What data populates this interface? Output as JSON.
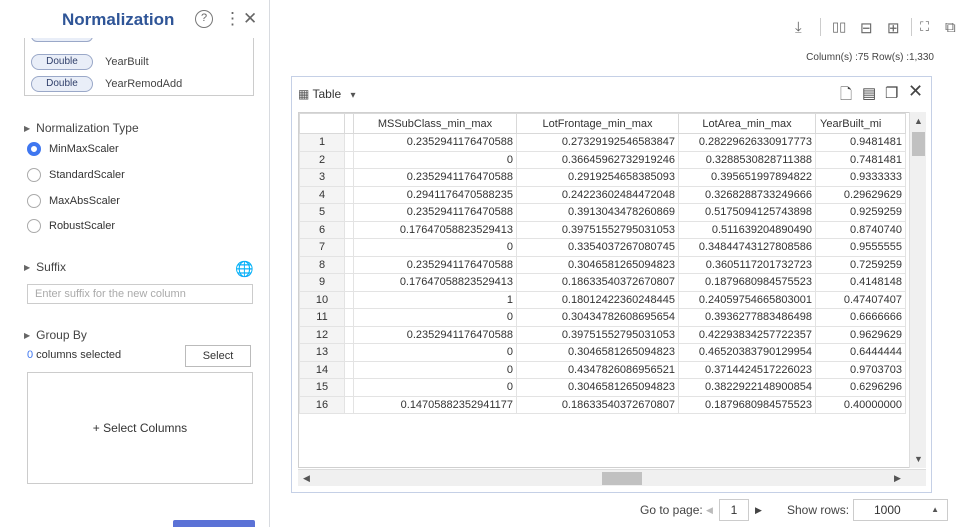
{
  "panel": {
    "title": "Normalization",
    "help_icon": "?",
    "more_icon": "⋮",
    "close_icon": "✕",
    "columns": [
      {
        "type": "Double",
        "name": "YearBuilt"
      },
      {
        "type": "Double",
        "name": "YearRemodAdd"
      }
    ],
    "normalization_type_label": "Normalization Type",
    "normalization_options": [
      "MinMaxScaler",
      "StandardScaler",
      "MaxAbsScaler",
      "RobustScaler"
    ],
    "selected_option": "MinMaxScaler",
    "suffix_label": "Suffix",
    "suffix_placeholder": "Enter suffix for the new column",
    "group_by_label": "Group By",
    "columns_selected_count": "0",
    "columns_selected_text": " columns selected",
    "select_button": "Select",
    "select_columns_text": "+ Select Columns"
  },
  "toolbar": {
    "icons": [
      "download-icon",
      "split-columns-icon",
      "split-rows-icon",
      "grid-view-icon",
      "expand-icon",
      "open-new-icon"
    ]
  },
  "counts_text": "Column(s) :75  Row(s) :1,330",
  "table": {
    "title": "Table",
    "dropdown_caret": "▾",
    "columns": [
      "MSSubClass_min_max",
      "LotFrontage_min_max",
      "LotArea_min_max",
      "YearBuilt_mi"
    ],
    "rows": [
      [
        "1",
        "0.2352941176470588",
        "0.27329192546583847",
        "0.28229626330917773",
        "0.9481481"
      ],
      [
        "2",
        "0",
        "0.36645962732919246",
        "0.3288530828711388",
        "0.7481481"
      ],
      [
        "3",
        "0.2352941176470588",
        "0.2919254658385093",
        "0.395651997894822",
        "0.9333333"
      ],
      [
        "4",
        "0.2941176470588235",
        "0.24223602484472048",
        "0.3268288733249666",
        "0.29629629"
      ],
      [
        "5",
        "0.2352941176470588",
        "0.3913043478260869",
        "0.5175094125743898",
        "0.9259259"
      ],
      [
        "6",
        "0.17647058823529413",
        "0.39751552795031053",
        "0.511639204890490",
        "0.8740740"
      ],
      [
        "7",
        "0",
        "0.3354037267080745",
        "0.34844743127808586",
        "0.9555555"
      ],
      [
        "8",
        "0.2352941176470588",
        "0.3046581265094823",
        "0.3605117201732723",
        "0.7259259"
      ],
      [
        "9",
        "0.17647058823529413",
        "0.18633540372670807",
        "0.1879680984575523",
        "0.4148148"
      ],
      [
        "10",
        "1",
        "0.18012422360248445",
        "0.24059754665803001",
        "0.47407407"
      ],
      [
        "11",
        "0",
        "0.30434782608695654",
        "0.3936277883486498",
        "0.6666666"
      ],
      [
        "12",
        "0.2352941176470588",
        "0.39751552795031053",
        "0.42293834257722357",
        "0.9629629"
      ],
      [
        "13",
        "0",
        "0.3046581265094823",
        "0.46520383790129954",
        "0.6444444"
      ],
      [
        "14",
        "0",
        "0.4347826086956521",
        "0.3714424517226023",
        "0.9703703"
      ],
      [
        "15",
        "0",
        "0.3046581265094823",
        "0.3822922148900854",
        "0.6296296"
      ],
      [
        "16",
        "0.14705882352941177",
        "0.18633540372670807",
        "0.1879680984575523",
        "0.40000000"
      ]
    ]
  },
  "pager": {
    "go_to_page_label": "Go to page:",
    "page": "1",
    "show_rows_label": "Show rows:",
    "rows_value": "1000"
  }
}
